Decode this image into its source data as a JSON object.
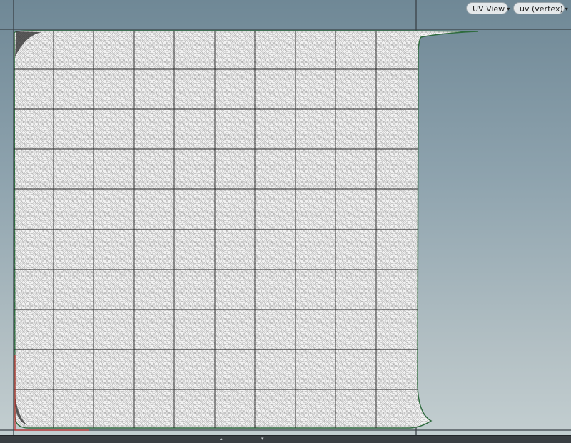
{
  "toolbar": {
    "view_menu_label": "UV View",
    "attribute_menu_label": "uv (vertex)",
    "caret_glyph": "▾"
  },
  "bottom_bar": {
    "handle_glyph": "·······",
    "collapse_left_glyph": "▴",
    "collapse_right_glyph": "▾"
  },
  "uv_viewport": {
    "grid_divisions": 10,
    "mesh_color": "#ffffff",
    "edge_color": "#222222",
    "boundary_color": "#2e6b3e",
    "selection_color": "#c33030",
    "axis_line_color": "#3b4248"
  }
}
